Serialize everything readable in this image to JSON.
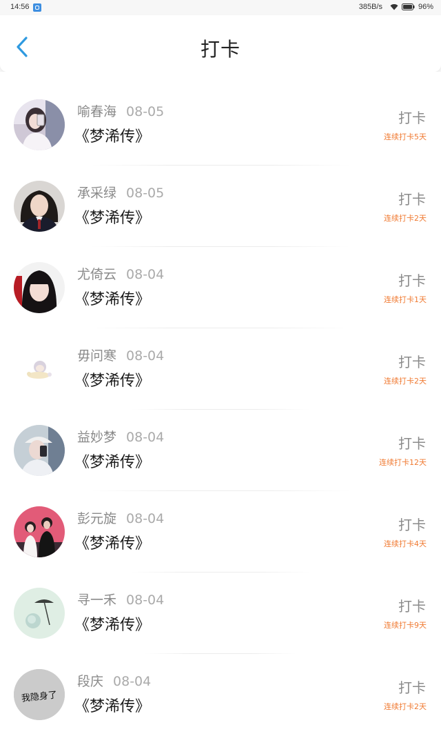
{
  "status_bar": {
    "time": "14:56",
    "speed": "385B/s",
    "battery": "96%"
  },
  "header": {
    "title": "打卡",
    "back_icon": "chevron-left-icon"
  },
  "colors": {
    "accent": "#2f9ae0",
    "streak": "#f07a32"
  },
  "items": [
    {
      "name": "喻春海",
      "date": "08-05",
      "book": "《梦浠传》",
      "action": "打卡",
      "streak": "连续打卡5天",
      "avatar": "photo-girl-with-phone"
    },
    {
      "name": "承采绿",
      "date": "08-05",
      "book": "《梦浠传》",
      "action": "打卡",
      "streak": "连续打卡2天",
      "avatar": "photo-girl-uniform"
    },
    {
      "name": "尤倚云",
      "date": "08-04",
      "book": "《梦浠传》",
      "action": "打卡",
      "streak": "连续打卡1天",
      "avatar": "photo-girl-bangs"
    },
    {
      "name": "毋问寒",
      "date": "08-04",
      "book": "《梦浠传》",
      "action": "打卡",
      "streak": "连续打卡2天",
      "avatar": "cartoon-character"
    },
    {
      "name": "益妙梦",
      "date": "08-04",
      "book": "《梦浠传》",
      "action": "打卡",
      "streak": "连续打卡12天",
      "avatar": "photo-girl-cap"
    },
    {
      "name": "彭元旋",
      "date": "08-04",
      "book": "《梦浠传》",
      "action": "打卡",
      "streak": "连续打卡4天",
      "avatar": "photo-couple"
    },
    {
      "name": "寻一禾",
      "date": "08-04",
      "book": "《梦浠传》",
      "action": "打卡",
      "streak": "连续打卡9天",
      "avatar": "flower-umbrella"
    },
    {
      "name": "段庆",
      "date": "08-04",
      "book": "《梦浠传》",
      "action": "打卡",
      "streak": "连续打卡2天",
      "avatar": "text-avatar",
      "avatar_text": "我隐身了"
    }
  ]
}
